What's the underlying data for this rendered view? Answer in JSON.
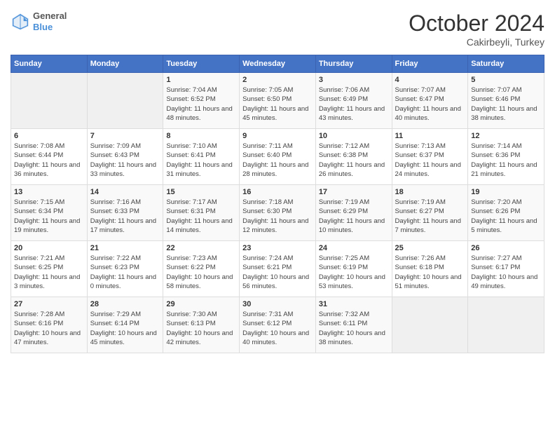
{
  "header": {
    "logo_line1": "General",
    "logo_line2": "Blue",
    "month": "October 2024",
    "location": "Cakirbeyli, Turkey"
  },
  "columns": [
    "Sunday",
    "Monday",
    "Tuesday",
    "Wednesday",
    "Thursday",
    "Friday",
    "Saturday"
  ],
  "weeks": [
    [
      {
        "day": "",
        "empty": true
      },
      {
        "day": "",
        "empty": true
      },
      {
        "day": "1",
        "sunrise": "Sunrise: 7:04 AM",
        "sunset": "Sunset: 6:52 PM",
        "daylight": "Daylight: 11 hours and 48 minutes."
      },
      {
        "day": "2",
        "sunrise": "Sunrise: 7:05 AM",
        "sunset": "Sunset: 6:50 PM",
        "daylight": "Daylight: 11 hours and 45 minutes."
      },
      {
        "day": "3",
        "sunrise": "Sunrise: 7:06 AM",
        "sunset": "Sunset: 6:49 PM",
        "daylight": "Daylight: 11 hours and 43 minutes."
      },
      {
        "day": "4",
        "sunrise": "Sunrise: 7:07 AM",
        "sunset": "Sunset: 6:47 PM",
        "daylight": "Daylight: 11 hours and 40 minutes."
      },
      {
        "day": "5",
        "sunrise": "Sunrise: 7:07 AM",
        "sunset": "Sunset: 6:46 PM",
        "daylight": "Daylight: 11 hours and 38 minutes."
      }
    ],
    [
      {
        "day": "6",
        "sunrise": "Sunrise: 7:08 AM",
        "sunset": "Sunset: 6:44 PM",
        "daylight": "Daylight: 11 hours and 36 minutes."
      },
      {
        "day": "7",
        "sunrise": "Sunrise: 7:09 AM",
        "sunset": "Sunset: 6:43 PM",
        "daylight": "Daylight: 11 hours and 33 minutes."
      },
      {
        "day": "8",
        "sunrise": "Sunrise: 7:10 AM",
        "sunset": "Sunset: 6:41 PM",
        "daylight": "Daylight: 11 hours and 31 minutes."
      },
      {
        "day": "9",
        "sunrise": "Sunrise: 7:11 AM",
        "sunset": "Sunset: 6:40 PM",
        "daylight": "Daylight: 11 hours and 28 minutes."
      },
      {
        "day": "10",
        "sunrise": "Sunrise: 7:12 AM",
        "sunset": "Sunset: 6:38 PM",
        "daylight": "Daylight: 11 hours and 26 minutes."
      },
      {
        "day": "11",
        "sunrise": "Sunrise: 7:13 AM",
        "sunset": "Sunset: 6:37 PM",
        "daylight": "Daylight: 11 hours and 24 minutes."
      },
      {
        "day": "12",
        "sunrise": "Sunrise: 7:14 AM",
        "sunset": "Sunset: 6:36 PM",
        "daylight": "Daylight: 11 hours and 21 minutes."
      }
    ],
    [
      {
        "day": "13",
        "sunrise": "Sunrise: 7:15 AM",
        "sunset": "Sunset: 6:34 PM",
        "daylight": "Daylight: 11 hours and 19 minutes."
      },
      {
        "day": "14",
        "sunrise": "Sunrise: 7:16 AM",
        "sunset": "Sunset: 6:33 PM",
        "daylight": "Daylight: 11 hours and 17 minutes."
      },
      {
        "day": "15",
        "sunrise": "Sunrise: 7:17 AM",
        "sunset": "Sunset: 6:31 PM",
        "daylight": "Daylight: 11 hours and 14 minutes."
      },
      {
        "day": "16",
        "sunrise": "Sunrise: 7:18 AM",
        "sunset": "Sunset: 6:30 PM",
        "daylight": "Daylight: 11 hours and 12 minutes."
      },
      {
        "day": "17",
        "sunrise": "Sunrise: 7:19 AM",
        "sunset": "Sunset: 6:29 PM",
        "daylight": "Daylight: 11 hours and 10 minutes."
      },
      {
        "day": "18",
        "sunrise": "Sunrise: 7:19 AM",
        "sunset": "Sunset: 6:27 PM",
        "daylight": "Daylight: 11 hours and 7 minutes."
      },
      {
        "day": "19",
        "sunrise": "Sunrise: 7:20 AM",
        "sunset": "Sunset: 6:26 PM",
        "daylight": "Daylight: 11 hours and 5 minutes."
      }
    ],
    [
      {
        "day": "20",
        "sunrise": "Sunrise: 7:21 AM",
        "sunset": "Sunset: 6:25 PM",
        "daylight": "Daylight: 11 hours and 3 minutes."
      },
      {
        "day": "21",
        "sunrise": "Sunrise: 7:22 AM",
        "sunset": "Sunset: 6:23 PM",
        "daylight": "Daylight: 11 hours and 0 minutes."
      },
      {
        "day": "22",
        "sunrise": "Sunrise: 7:23 AM",
        "sunset": "Sunset: 6:22 PM",
        "daylight": "Daylight: 10 hours and 58 minutes."
      },
      {
        "day": "23",
        "sunrise": "Sunrise: 7:24 AM",
        "sunset": "Sunset: 6:21 PM",
        "daylight": "Daylight: 10 hours and 56 minutes."
      },
      {
        "day": "24",
        "sunrise": "Sunrise: 7:25 AM",
        "sunset": "Sunset: 6:19 PM",
        "daylight": "Daylight: 10 hours and 53 minutes."
      },
      {
        "day": "25",
        "sunrise": "Sunrise: 7:26 AM",
        "sunset": "Sunset: 6:18 PM",
        "daylight": "Daylight: 10 hours and 51 minutes."
      },
      {
        "day": "26",
        "sunrise": "Sunrise: 7:27 AM",
        "sunset": "Sunset: 6:17 PM",
        "daylight": "Daylight: 10 hours and 49 minutes."
      }
    ],
    [
      {
        "day": "27",
        "sunrise": "Sunrise: 7:28 AM",
        "sunset": "Sunset: 6:16 PM",
        "daylight": "Daylight: 10 hours and 47 minutes."
      },
      {
        "day": "28",
        "sunrise": "Sunrise: 7:29 AM",
        "sunset": "Sunset: 6:14 PM",
        "daylight": "Daylight: 10 hours and 45 minutes."
      },
      {
        "day": "29",
        "sunrise": "Sunrise: 7:30 AM",
        "sunset": "Sunset: 6:13 PM",
        "daylight": "Daylight: 10 hours and 42 minutes."
      },
      {
        "day": "30",
        "sunrise": "Sunrise: 7:31 AM",
        "sunset": "Sunset: 6:12 PM",
        "daylight": "Daylight: 10 hours and 40 minutes."
      },
      {
        "day": "31",
        "sunrise": "Sunrise: 7:32 AM",
        "sunset": "Sunset: 6:11 PM",
        "daylight": "Daylight: 10 hours and 38 minutes."
      },
      {
        "day": "",
        "empty": true
      },
      {
        "day": "",
        "empty": true
      }
    ]
  ]
}
